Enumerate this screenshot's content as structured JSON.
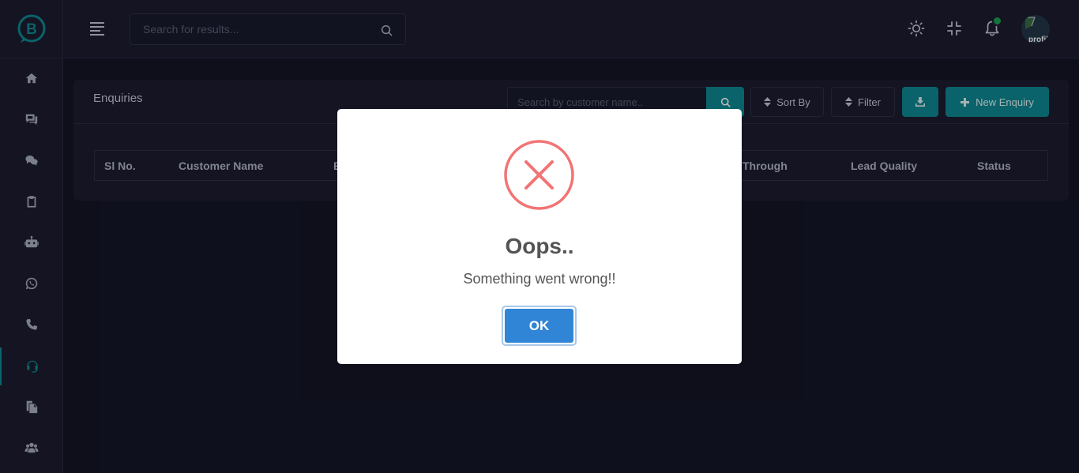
{
  "header": {
    "search_placeholder": "Search for results..."
  },
  "avatar": {
    "alt_text": "profil"
  },
  "sidebar": {
    "items": [
      {
        "icon": "home-icon"
      },
      {
        "icon": "chat-bubbles-icon"
      },
      {
        "icon": "wechat-icon"
      },
      {
        "icon": "clipboard-icon"
      },
      {
        "icon": "robot-icon"
      },
      {
        "icon": "whatsapp-icon"
      },
      {
        "icon": "phone-icon"
      },
      {
        "icon": "headset-icon",
        "active": true
      },
      {
        "icon": "files-icon"
      },
      {
        "icon": "users-icon"
      }
    ]
  },
  "card": {
    "title": "Enquiries",
    "customer_search_placeholder": "Search by customer name..",
    "sort_label": "Sort By",
    "filter_label": "Filter",
    "new_enquiry_label": "New Enquiry"
  },
  "table": {
    "columns": [
      "Sl No.",
      "Customer Name",
      "E",
      "Through",
      "Lead Quality",
      "Status"
    ]
  },
  "modal": {
    "title": "Oops..",
    "message": "Something went wrong!!",
    "ok_label": "OK"
  },
  "colors": {
    "accent": "#0f8a94",
    "error": "#f27474",
    "confirm": "#3085d6",
    "notification": "#1aa351"
  }
}
